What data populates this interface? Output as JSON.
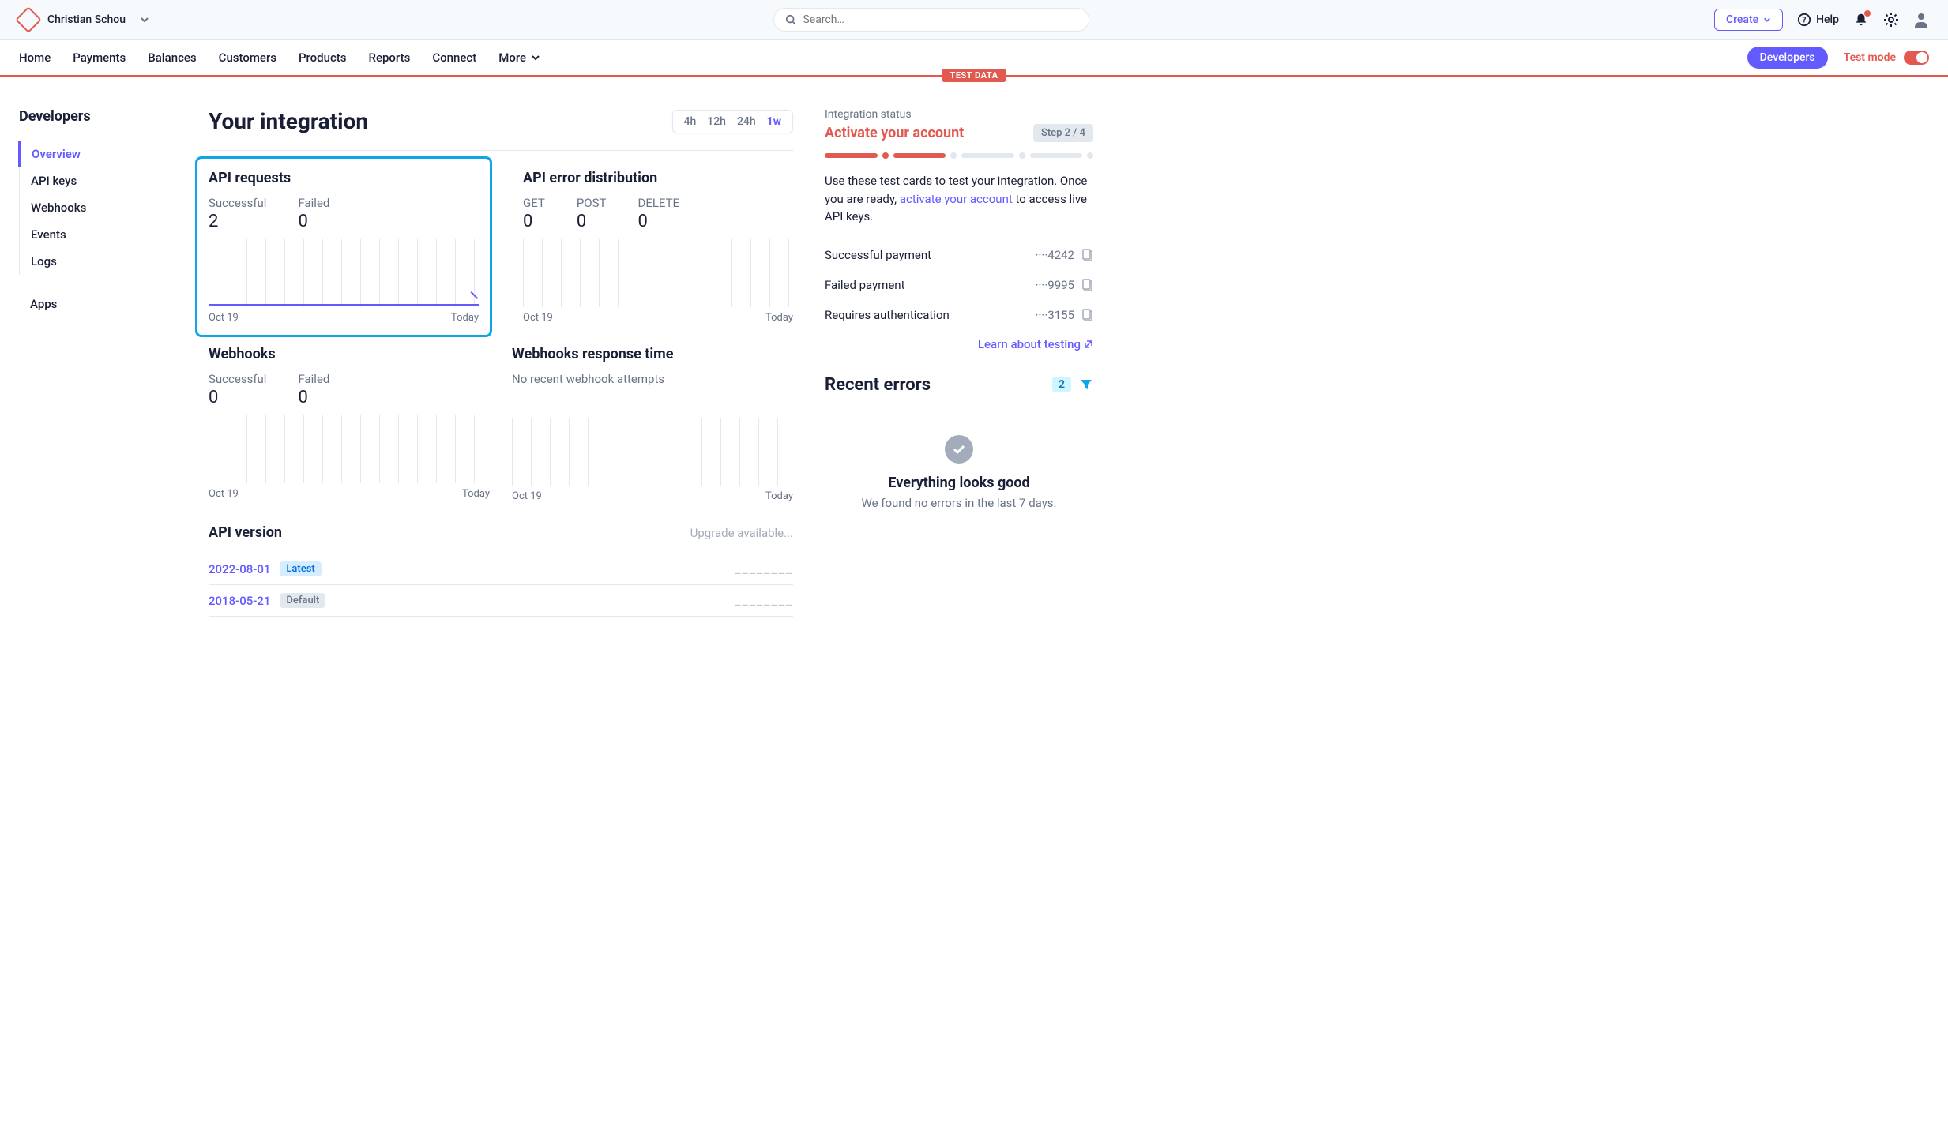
{
  "topbar": {
    "account_name": "Christian Schou",
    "search_placeholder": "Search…",
    "create_label": "Create",
    "help_label": "Help"
  },
  "nav": {
    "items": [
      "Home",
      "Payments",
      "Balances",
      "Customers",
      "Products",
      "Reports",
      "Connect",
      "More"
    ],
    "developers_label": "Developers",
    "testmode_label": "Test mode",
    "test_data_badge": "TEST DATA"
  },
  "sidebar": {
    "title": "Developers",
    "items": [
      "Overview",
      "API keys",
      "Webhooks",
      "Events",
      "Logs"
    ],
    "apps_label": "Apps",
    "active_index": 0
  },
  "main": {
    "title": "Your integration",
    "time_ranges": [
      "4h",
      "12h",
      "24h",
      "1w"
    ],
    "active_range_index": 3,
    "api_requests": {
      "title": "API requests",
      "successful_label": "Successful",
      "successful_value": "2",
      "failed_label": "Failed",
      "failed_value": "0",
      "x_start": "Oct 19",
      "x_end": "Today"
    },
    "api_errors": {
      "title": "API error distribution",
      "methods": [
        {
          "label": "GET",
          "value": "0"
        },
        {
          "label": "POST",
          "value": "0"
        },
        {
          "label": "DELETE",
          "value": "0"
        }
      ],
      "x_start": "Oct 19",
      "x_end": "Today"
    },
    "webhooks": {
      "title": "Webhooks",
      "successful_label": "Successful",
      "successful_value": "0",
      "failed_label": "Failed",
      "failed_value": "0",
      "x_start": "Oct 19",
      "x_end": "Today"
    },
    "webhooks_rt": {
      "title": "Webhooks response time",
      "no_attempts": "No recent webhook attempts",
      "x_start": "Oct 19",
      "x_end": "Today"
    },
    "api_version": {
      "title": "API version",
      "upgrade_text": "Upgrade available...",
      "versions": [
        {
          "date": "2022-08-01",
          "badge": "Latest",
          "badge_type": "latest"
        },
        {
          "date": "2018-05-21",
          "badge": "Default",
          "badge_type": "default"
        }
      ]
    }
  },
  "right": {
    "integration_status_label": "Integration status",
    "activate_title": "Activate your account",
    "step_label": "Step 2 / 4",
    "description_pre": "Use these test cards to test your integration. Once you are ready, ",
    "description_link": "activate your account",
    "description_post": " to access live API keys.",
    "test_cards": [
      {
        "label": "Successful payment",
        "number": "····4242"
      },
      {
        "label": "Failed payment",
        "number": "····9995"
      },
      {
        "label": "Requires authentication",
        "number": "····3155"
      }
    ],
    "learn_link": "Learn about testing",
    "recent_errors_title": "Recent errors",
    "recent_errors_count": "2",
    "all_good_title": "Everything looks good",
    "all_good_sub": "We found no errors in the last 7 days."
  },
  "chart_data": [
    {
      "type": "line",
      "title": "API requests",
      "x_range": [
        "Oct 19",
        "Today"
      ],
      "series": [
        {
          "name": "Successful",
          "total": 2,
          "approx_values_flat_until_end_then_spike": true
        },
        {
          "name": "Failed",
          "total": 0
        }
      ]
    },
    {
      "type": "line",
      "title": "API error distribution",
      "x_range": [
        "Oct 19",
        "Today"
      ],
      "series": [
        {
          "name": "GET",
          "total": 0
        },
        {
          "name": "POST",
          "total": 0
        },
        {
          "name": "DELETE",
          "total": 0
        }
      ]
    },
    {
      "type": "line",
      "title": "Webhooks",
      "x_range": [
        "Oct 19",
        "Today"
      ],
      "series": [
        {
          "name": "Successful",
          "total": 0
        },
        {
          "name": "Failed",
          "total": 0
        }
      ]
    },
    {
      "type": "line",
      "title": "Webhooks response time",
      "x_range": [
        "Oct 19",
        "Today"
      ],
      "series": []
    }
  ]
}
